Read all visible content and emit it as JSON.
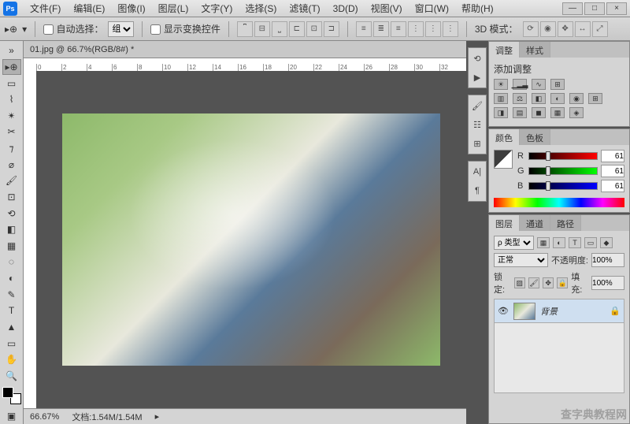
{
  "app": {
    "logo": "Ps"
  },
  "menu": {
    "file": "文件(F)",
    "edit": "编辑(E)",
    "image": "图像(I)",
    "layer": "图层(L)",
    "type": "文字(Y)",
    "select": "选择(S)",
    "filter": "滤镜(T)",
    "threeD": "3D(D)",
    "view": "视图(V)",
    "window": "窗口(W)",
    "help": "帮助(H)"
  },
  "options": {
    "autoSelectLabel": "自动选择：",
    "autoSelectChecked": false,
    "selectMode": "组",
    "showTransformLabel": "显示变换控件",
    "showTransformChecked": false,
    "mode3dLabel": "3D 模式："
  },
  "document": {
    "tabTitle": "01.jpg @ 66.7%(RGB/8#) *",
    "zoom": "66.67%",
    "docSize": "文档:1.54M/1.54M"
  },
  "ruler": [
    "0",
    "2",
    "4",
    "6",
    "8",
    "10",
    "12",
    "14",
    "16",
    "18",
    "20",
    "22",
    "24",
    "26",
    "28",
    "30",
    "32"
  ],
  "panels": {
    "adjustments": {
      "tab1": "调整",
      "tab2": "样式",
      "title": "添加调整"
    },
    "color": {
      "tab1": "颜色",
      "tab2": "色板",
      "rLabel": "R",
      "gLabel": "G",
      "bLabel": "B",
      "rValue": "61",
      "gValue": "61",
      "bValue": "61"
    },
    "layers": {
      "tab1": "图层",
      "tab2": "通道",
      "tab3": "路径",
      "kindLabel": "ρ 类型",
      "blendMode": "正常",
      "opacityLabel": "不透明度:",
      "opacityValue": "100%",
      "lockLabel": "锁定:",
      "fillLabel": "填充:",
      "fillValue": "100%",
      "layer0Name": "背景"
    }
  },
  "watermark": "查字典教程网"
}
